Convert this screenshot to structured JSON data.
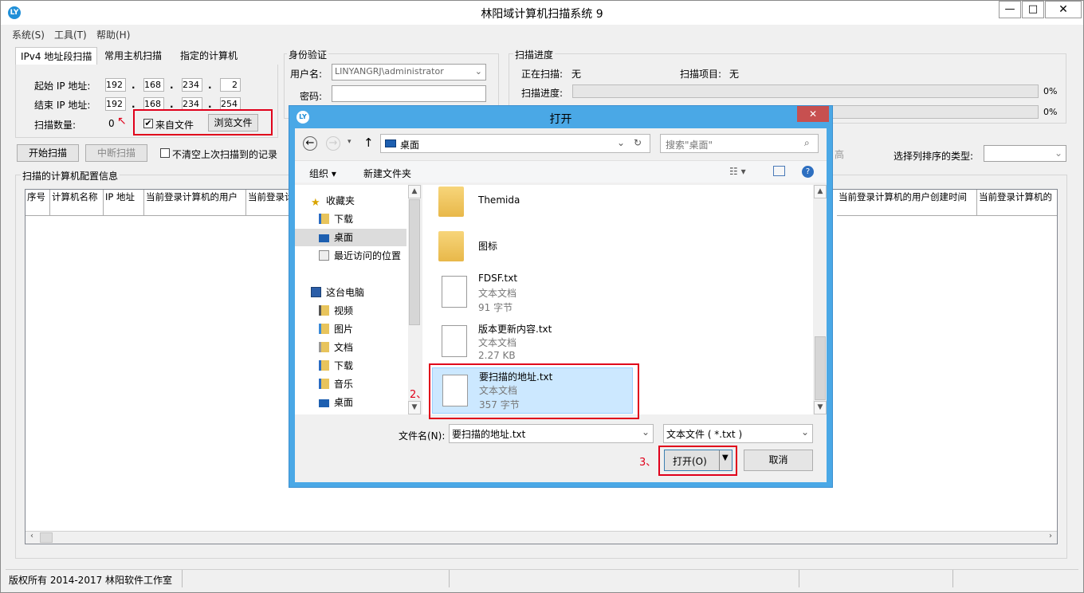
{
  "app": {
    "title": "林阳域计算机扫描系统 9",
    "icon_text": "LY"
  },
  "window_controls": {
    "minimize": "—",
    "maximize": "□",
    "close": "✕"
  },
  "menu": [
    "系统(S)",
    "工具(T)",
    "帮助(H)"
  ],
  "scan_tabs": [
    "IPv4 地址段扫描",
    "常用主机扫描",
    "指定的计算机"
  ],
  "ip_section": {
    "start_label": "起始 IP 地址:",
    "start_ip": [
      "192",
      "168",
      "234",
      "2"
    ],
    "end_label": "结束 IP 地址:",
    "end_ip": [
      "192",
      "168",
      "234",
      "254"
    ],
    "count_label": "扫描数量:",
    "count_value": "0",
    "from_file_label": "来自文件",
    "from_file_checked": "✔",
    "browse_button": "浏览文件"
  },
  "auth": {
    "title": "身份验证",
    "user_label": "用户名:",
    "user_value": "LINYANGRJ\\administrator",
    "password_label": "密码:",
    "password_value": ""
  },
  "progress": {
    "title": "扫描进度",
    "scanning_label": "正在扫描:",
    "scanning_value": "无",
    "item_label": "扫描项目:",
    "item_value": "无",
    "progress_label": "扫描进度:",
    "progress1": "0%",
    "progress2": "0%"
  },
  "actions": {
    "start": "开始扫描",
    "stop": "中断扫描",
    "keep_label": "不清空上次扫描到的记录",
    "hidden_button": "高",
    "sort_label": "选择列排序的类型:"
  },
  "results": {
    "title": "扫描的计算机配置信息",
    "columns_left": [
      "序号",
      "计算机名称",
      "IP 地址",
      "当前登录计算机的用户",
      "当前登录计"
    ],
    "columns_right": [
      "当前登录计算机的用户创建时间",
      "当前登录计算机的"
    ]
  },
  "status": {
    "copyright": "版权所有 2014-2017 林阳软件工作室"
  },
  "dialog": {
    "title": "打开",
    "close": "✕",
    "path": "桌面",
    "search_placeholder": "搜索\"桌面\"",
    "organize": "组织 ▾",
    "new_folder": "新建文件夹",
    "nav": {
      "favorites": "收藏夹",
      "fav_items": [
        "下载",
        "桌面",
        "最近访问的位置"
      ],
      "pc": "这台电脑",
      "pc_items": [
        "视频",
        "图片",
        "文档",
        "下载",
        "音乐",
        "桌面"
      ]
    },
    "folders": [
      "Themida",
      "图标"
    ],
    "files": [
      {
        "name": "FDSF.txt",
        "type": "文本文档",
        "size": "91 字节"
      },
      {
        "name": "版本更新内容.txt",
        "type": "文本文档",
        "size": "2.27 KB"
      },
      {
        "name": "要扫描的地址.txt",
        "type": "文本文档",
        "size": "357 字节"
      }
    ],
    "filename_label": "文件名(N):",
    "filename_value": "要扫描的地址.txt",
    "filter_value": "文本文件 ( *.txt )",
    "open_button": "打开(O)",
    "cancel_button": "取消"
  },
  "annotations": {
    "step2": "2、",
    "step3": "3、",
    "arrow": "↖"
  },
  "colors": {
    "highlight_red": "#e0001b",
    "dialog_border": "#4aa8e6",
    "selection": "#cce8ff",
    "close_red": "#c75050"
  }
}
